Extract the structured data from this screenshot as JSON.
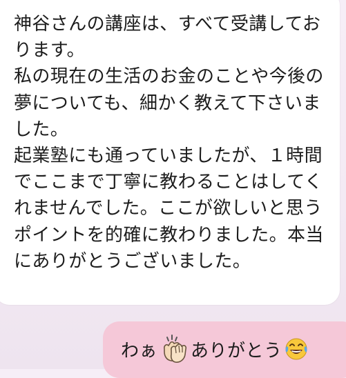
{
  "messages": {
    "incoming": {
      "text": "神谷さんの講座は、すべて受講しております。\n私の現在の生活のお金のことや今後の夢についても、細かく教えて下さいました。\n起業塾にも通っていましたが、１時間でここまで丁寧に教わることはしてくれませんでした。ここが欲しいと思うポイントを的確に教わりました。本当にありがとうございました。"
    },
    "outgoing": {
      "text_before": "わぁ",
      "emoji_1": "clapping-hands-emoji",
      "text_after": "ありがとう",
      "emoji_2": "tears-of-joy-emoji"
    }
  },
  "colors": {
    "incoming_bubble": "#ffffff",
    "outgoing_bubble": "#f5c8d8",
    "background": "#f4ecf5",
    "text": "#1c1c1c"
  }
}
